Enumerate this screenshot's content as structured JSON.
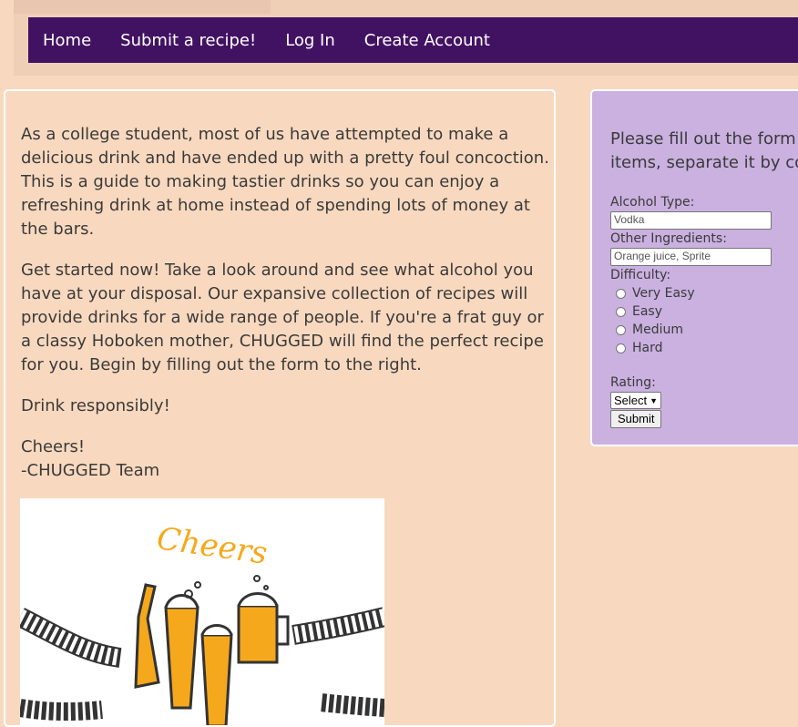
{
  "nav": {
    "home": "Home",
    "submit": "Submit a recipe!",
    "login": "Log In",
    "create": "Create Account"
  },
  "main": {
    "p1": "As a college student, most of us have attempted to make a delicious drink and have ended up with a pretty foul concoction. This is a guide to making tastier drinks so you can enjoy a refreshing drink at home instead of spending lots of money at the bars.",
    "p2": "Get started now! Take a look around and see what alcohol you have at your disposal. Our expansive collection of recipes will provide drinks for a wide range of people. If you're a frat guy or a classy Hoboken mother, CHUGGED will find the perfect recipe for you. Begin by filling out the form to the right.",
    "p3": "Drink responsibly!",
    "sign1": "Cheers!",
    "sign2": "-CHUGGED Team",
    "image_text": "Cheers"
  },
  "form": {
    "intro_line1": "Please fill out the form",
    "intro_line2": "items, separate it by co",
    "alcohol_label": "Alcohol Type:",
    "alcohol_placeholder": "Vodka",
    "ingredients_label": "Other Ingredients:",
    "ingredients_placeholder": "Orange juice, Sprite",
    "difficulty_label": "Difficulty:",
    "difficulty_options": [
      "Very Easy",
      "Easy",
      "Medium",
      "Hard"
    ],
    "rating_label": "Rating:",
    "rating_selected": "Select",
    "submit_label": "Submit"
  },
  "colors": {
    "page_bg": "#f8d9bf",
    "nav_bg": "#421262",
    "form_bg": "#cab1e0",
    "beer": "#f6a81c"
  }
}
